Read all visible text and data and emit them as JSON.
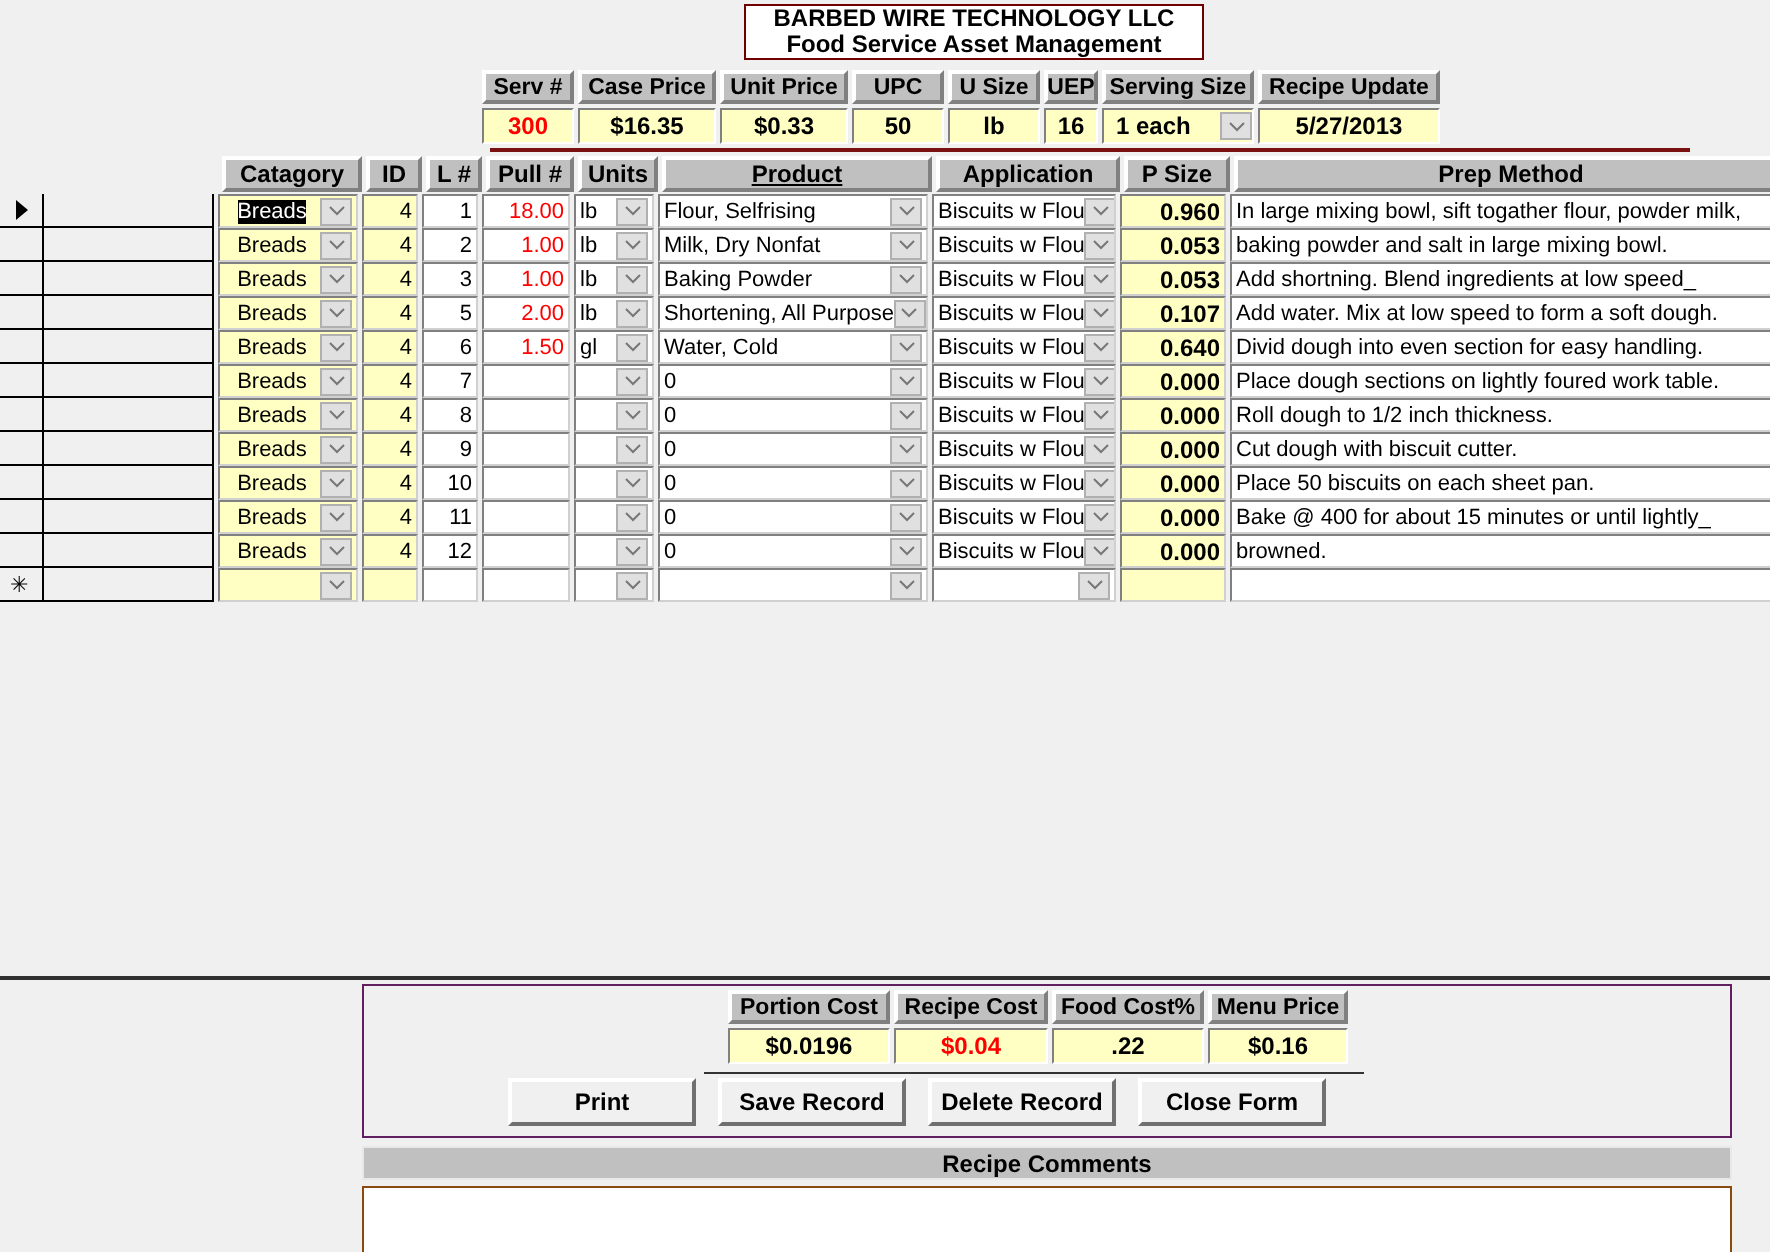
{
  "title_box": {
    "company": "BARBED WIRE TECHNOLOGY LLC",
    "subtitle": "Food Service Asset Management"
  },
  "fields": [
    {
      "label": "Serv #",
      "value": "300",
      "kind": "text",
      "warning": true
    },
    {
      "label": "Case Price",
      "value": "$16.35",
      "kind": "text",
      "warning": false
    },
    {
      "label": "Unit Price",
      "value": "$0.33",
      "kind": "text",
      "warning": false
    },
    {
      "label": "UPC",
      "value": "50",
      "kind": "text",
      "warning": false
    },
    {
      "label": "U Size",
      "value": "lb",
      "kind": "text",
      "warning": false
    },
    {
      "label": "UEP",
      "value": "16",
      "kind": "text",
      "warning": false
    },
    {
      "label": "Serving Size",
      "value": "1 each",
      "kind": "combo",
      "warning": false
    },
    {
      "label": "Recipe Update",
      "value": "5/27/2013",
      "kind": "text",
      "warning": false
    }
  ],
  "grid": {
    "columns": [
      {
        "label": "Catagory",
        "kind": "combo",
        "underlined": false,
        "warning": false
      },
      {
        "label": "ID",
        "kind": "number",
        "underlined": false,
        "warning": false
      },
      {
        "label": "L #",
        "kind": "number",
        "underlined": false,
        "warning": false
      },
      {
        "label": "Pull #",
        "kind": "number",
        "underlined": false,
        "warning": true
      },
      {
        "label": "Units",
        "kind": "combo",
        "underlined": false,
        "warning": false
      },
      {
        "label": "Product",
        "kind": "combo",
        "underlined": true,
        "warning": false
      },
      {
        "label": "Application",
        "kind": "combo",
        "underlined": false,
        "warning": false
      },
      {
        "label": "P Size",
        "kind": "number",
        "underlined": false,
        "warning": false
      },
      {
        "label": "Prep Method",
        "kind": "text",
        "underlined": false,
        "warning": false
      }
    ],
    "rows": [
      {
        "selected": true,
        "cells": [
          "Breads",
          "4",
          "1",
          "18.00",
          "lb",
          "Flour, Selfrising",
          "Biscuits w Flou",
          "0.960",
          "In large mixing bowl, sift togather flour, powder milk,"
        ]
      },
      {
        "selected": false,
        "cells": [
          "Breads",
          "4",
          "2",
          "1.00",
          "lb",
          "Milk, Dry Nonfat",
          "Biscuits w Flou",
          "0.053",
          "baking powder and salt in large mixing bowl."
        ]
      },
      {
        "selected": false,
        "cells": [
          "Breads",
          "4",
          "3",
          "1.00",
          "lb",
          "Baking Powder",
          "Biscuits w Flou",
          "0.053",
          "Add shortning. Blend ingredients at low speed_"
        ]
      },
      {
        "selected": false,
        "cells": [
          "Breads",
          "4",
          "5",
          "2.00",
          "lb",
          "Shortening, All Purpose",
          "Biscuits w Flou",
          "0.107",
          "Add water. Mix at low speed to form a soft dough."
        ]
      },
      {
        "selected": false,
        "cells": [
          "Breads",
          "4",
          "6",
          "1.50",
          "gl",
          "Water, Cold",
          "Biscuits w Flou",
          "0.640",
          "Divid dough into even section for easy handling."
        ]
      },
      {
        "selected": false,
        "cells": [
          "Breads",
          "4",
          "7",
          null,
          null,
          "0",
          "Biscuits w Flou",
          "0.000",
          "Place dough sections on lightly foured work table."
        ]
      },
      {
        "selected": false,
        "cells": [
          "Breads",
          "4",
          "8",
          null,
          null,
          "0",
          "Biscuits w Flou",
          "0.000",
          "Roll dough to 1/2 inch thickness."
        ]
      },
      {
        "selected": false,
        "cells": [
          "Breads",
          "4",
          "9",
          null,
          null,
          "0",
          "Biscuits w Flou",
          "0.000",
          "Cut dough with biscuit cutter."
        ]
      },
      {
        "selected": false,
        "cells": [
          "Breads",
          "4",
          "10",
          null,
          null,
          "0",
          "Biscuits w Flou",
          "0.000",
          "Place 50 biscuits on each sheet pan."
        ]
      },
      {
        "selected": false,
        "cells": [
          "Breads",
          "4",
          "11",
          null,
          null,
          "0",
          "Biscuits w Flou",
          "0.000",
          "Bake @ 400 for about 15 minutes or until lightly_"
        ]
      },
      {
        "selected": false,
        "cells": [
          "Breads",
          "4",
          "12",
          null,
          null,
          "0",
          "Biscuits w Flou",
          "0.000",
          "browned."
        ]
      }
    ],
    "new_row": {
      "marker": "✳"
    }
  },
  "costs": [
    {
      "label": "Portion Cost",
      "value": "$0.0196",
      "warning": false
    },
    {
      "label": "Recipe Cost",
      "value": "$0.04",
      "warning": true
    },
    {
      "label": "Food Cost%",
      "value": ".22",
      "warning": false
    },
    {
      "label": "Menu Price",
      "value": "$0.16",
      "warning": false
    }
  ],
  "buttons": [
    "Print",
    "Save Record",
    "Delete Record",
    "Close Form"
  ],
  "comments": {
    "label": "Recipe Comments"
  }
}
